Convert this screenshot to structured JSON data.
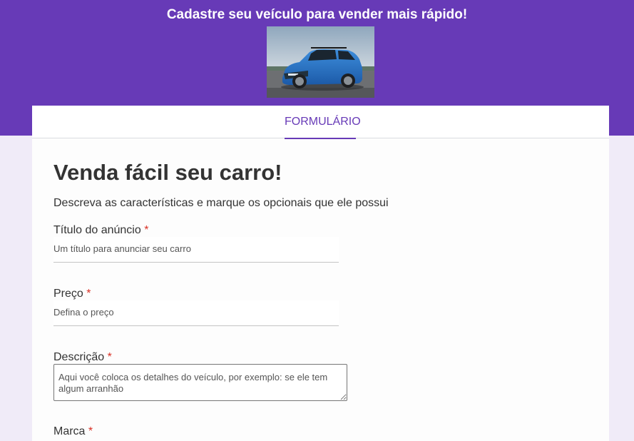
{
  "header": {
    "title": "Cadastre seu veículo para vender mais rápido!",
    "image_alt": "car-photo"
  },
  "tabs": [
    {
      "label": "FORMULÁRIO",
      "selected": true
    }
  ],
  "form": {
    "title": "Venda fácil seu carro!",
    "description": "Descreva as características e marque os opcionais que ele possui",
    "required_mark": "*",
    "fields": [
      {
        "label": "Título do anúncio",
        "placeholder": "Um título para anunciar seu carro",
        "value": ""
      },
      {
        "label": "Preço",
        "placeholder": "Defina o preço",
        "value": ""
      },
      {
        "label": "Descrição",
        "placeholder": "Aqui você coloca os detalhes do veículo, por exemplo: se ele tem algum arranhão",
        "value": ""
      },
      {
        "label": "Marca"
      }
    ]
  },
  "colors": {
    "accent": "#673ab7",
    "background": "#f0ebf8",
    "required": "#d93025"
  }
}
